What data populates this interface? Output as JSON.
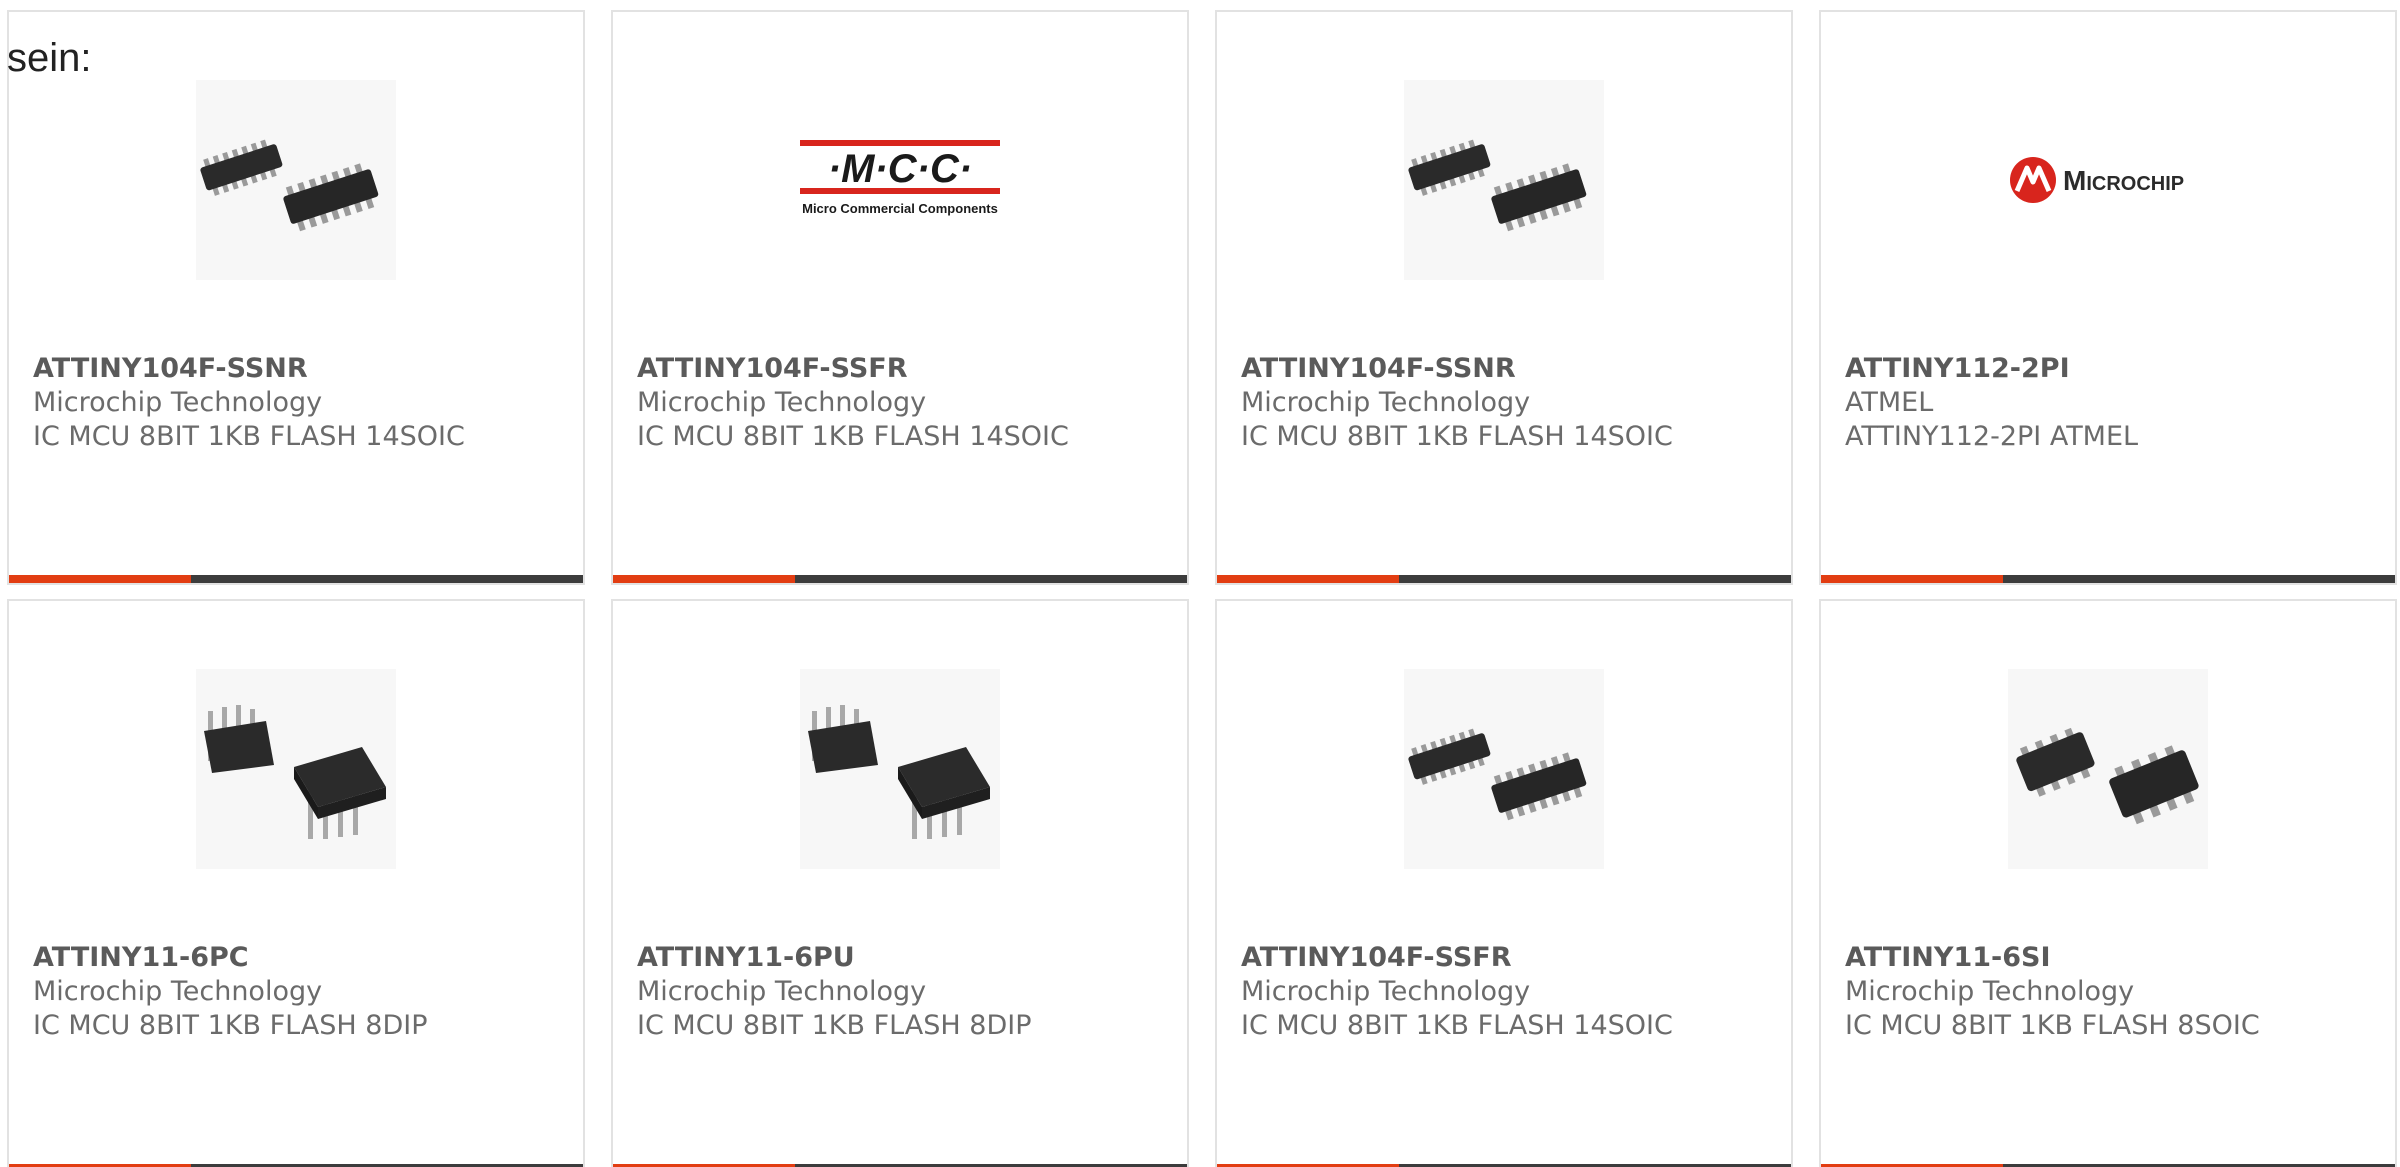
{
  "intro_text": "sein:",
  "colors": {
    "accent": "#e23d12",
    "bar_dark": "#3c3c3c",
    "card_border": "#e2e2e2",
    "text_gray": "#6b6b6b"
  },
  "logos": {
    "mcc": {
      "text": "·M·C·C·",
      "subtext": "Micro Commercial Components"
    },
    "microchip": {
      "text": "Microchip"
    }
  },
  "cards": [
    {
      "part_number": "ATTINY104F-SSNR",
      "manufacturer": "Microchip Technology",
      "description": "IC MCU 8BIT 1KB FLASH 14SOIC",
      "image": "soic-14-chip"
    },
    {
      "part_number": "ATTINY104F-SSFR",
      "manufacturer": "Microchip Technology",
      "description": "IC MCU 8BIT 1KB FLASH 14SOIC",
      "image": "mcc-logo"
    },
    {
      "part_number": "ATTINY104F-SSNR",
      "manufacturer": "Microchip Technology",
      "description": "IC MCU 8BIT 1KB FLASH 14SOIC",
      "image": "soic-14-chip"
    },
    {
      "part_number": "ATTINY112-2PI",
      "manufacturer": "ATMEL",
      "description": "ATTINY112-2PI ATMEL",
      "image": "microchip-logo"
    },
    {
      "part_number": "ATTINY11-6PC",
      "manufacturer": "Microchip Technology",
      "description": "IC MCU 8BIT 1KB FLASH 8DIP",
      "image": "dip-8-chip"
    },
    {
      "part_number": "ATTINY11-6PU",
      "manufacturer": "Microchip Technology",
      "description": "IC MCU 8BIT 1KB FLASH 8DIP",
      "image": "dip-8-chip"
    },
    {
      "part_number": "ATTINY104F-SSFR",
      "manufacturer": "Microchip Technology",
      "description": "IC MCU 8BIT 1KB FLASH 14SOIC",
      "image": "soic-14-chip"
    },
    {
      "part_number": "ATTINY11-6SI",
      "manufacturer": "Microchip Technology",
      "description": "IC MCU 8BIT 1KB FLASH 8SOIC",
      "image": "soic-8-chip"
    }
  ]
}
